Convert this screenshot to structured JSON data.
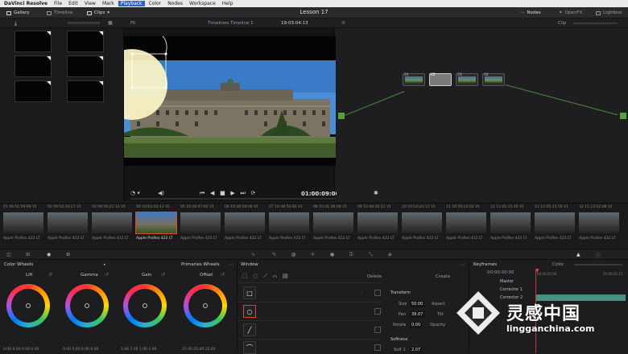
{
  "menubar": {
    "app": "DaVinci Resolve",
    "items": [
      "File",
      "Edit",
      "View",
      "Mark",
      "Playback",
      "Color",
      "Nodes",
      "Workspace",
      "Help"
    ],
    "active": "Playback"
  },
  "topbar": {
    "gallery": "Gallery",
    "timeline": "Timeline",
    "clips": "Clips",
    "project_title": "Lesson 17",
    "nodes": "Nodes",
    "openfx": "OpenFX",
    "lightbox": "Lightbox"
  },
  "viewer": {
    "fit": "Fit",
    "timeline_name": "Timelines Timeline 1",
    "timecode_top": "19:03:04:13",
    "timecode": "01:00:09:06"
  },
  "node_editor": {
    "mode": "Clip",
    "nodes": [
      {
        "num": "01"
      },
      {
        "num": "02"
      },
      {
        "num": "03"
      },
      {
        "num": "04"
      }
    ]
  },
  "clips": [
    {
      "num": "01",
      "tc": "09:51:59:09",
      "track": "V1",
      "codec": "Apple ProRes 422 LT"
    },
    {
      "num": "02",
      "tc": "09:54:34:21",
      "track": "V1",
      "codec": "Apple ProRes 422 LT"
    },
    {
      "num": "03",
      "tc": "09:56:21:12",
      "track": "V1",
      "codec": "Apple ProRes 422 LT"
    },
    {
      "num": "04",
      "tc": "10:03:04:13",
      "track": "V1",
      "codec": "Apple ProRes 422 LT"
    },
    {
      "num": "05",
      "tc": "10:29:47:02",
      "track": "V1",
      "codec": "Apple ProRes 422 LT"
    },
    {
      "num": "06",
      "tc": "10:30:34:06",
      "track": "V1",
      "codec": "Apple ProRes 422 LT"
    },
    {
      "num": "07",
      "tc": "10:38:50:06",
      "track": "V1",
      "codec": "Apple ProRes 422 LT"
    },
    {
      "num": "08",
      "tc": "10:41:36:08",
      "track": "V1",
      "codec": "Apple ProRes 422 LT"
    },
    {
      "num": "09",
      "tc": "10:48:20:12",
      "track": "V1",
      "codec": "Apple ProRes 422 LT"
    },
    {
      "num": "10",
      "tc": "10:54:41:11",
      "track": "V1",
      "codec": "Apple ProRes 422 LT"
    },
    {
      "num": "11",
      "tc": "10:59:23:02",
      "track": "V1",
      "codec": "Apple ProRes 422 LT"
    },
    {
      "num": "12",
      "tc": "11:05:15:16",
      "track": "V1",
      "codec": "Apple ProRes 422 LT"
    },
    {
      "num": "13",
      "tc": "11:05:25:16",
      "track": "V1",
      "codec": "Apple ProRes 422 LT"
    },
    {
      "num": "14",
      "tc": "11:10:22:08",
      "track": "V1",
      "codec": "Apple ProRes 422 LT"
    }
  ],
  "color_wheels": {
    "title": "Color Wheels",
    "mode": "Primaries Wheels",
    "wheels": [
      {
        "name": "Lift",
        "values": "0.00  0.00  0.00  0.00"
      },
      {
        "name": "Gamma",
        "values": "0.00  0.00  0.00  0.00"
      },
      {
        "name": "Gain",
        "values": "1.00  1.00  1.00  1.00"
      },
      {
        "name": "Offset",
        "values": "25.00  25.00  25.00"
      }
    ]
  },
  "window_panel": {
    "title": "Window",
    "delete": "Delete",
    "create": "Create",
    "transform_title": "Transform",
    "size_label": "Size",
    "size_val": "50.00",
    "aspect_label": "Aspect",
    "pan_label": "Pan",
    "pan_val": "39.07",
    "tilt_label": "Tilt",
    "rotate_label": "Rotate",
    "rotate_val": "0.00",
    "opacity_label": "Opacity",
    "softness_title": "Softness",
    "soft1_label": "Soft 1",
    "soft1_val": "2.07"
  },
  "keyframes": {
    "title": "Keyframes",
    "mode": "Color",
    "timecode_start": "00:00:00:00",
    "timecode_end": "00:00:02:13",
    "rows": [
      "Master",
      "Corrector 1",
      "Corrector 2"
    ]
  },
  "watermark": {
    "brand": "灵感中国",
    "url": "lingganchina.com"
  }
}
